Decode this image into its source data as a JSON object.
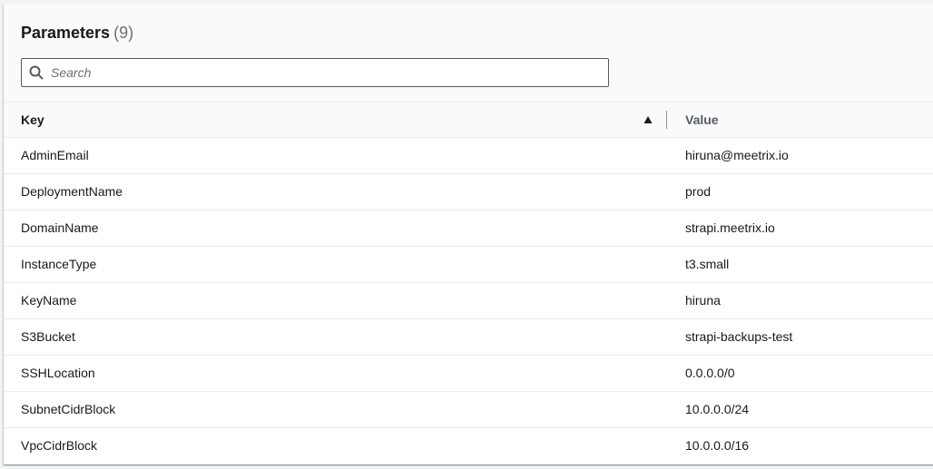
{
  "header": {
    "title": "Parameters",
    "count": "(9)"
  },
  "search": {
    "placeholder": "Search",
    "value": ""
  },
  "table": {
    "columns": {
      "key": "Key",
      "value": "Value"
    },
    "sort": {
      "column": "key",
      "direction": "ascending"
    },
    "rows": [
      {
        "key": "AdminEmail",
        "value": "hiruna@meetrix.io"
      },
      {
        "key": "DeploymentName",
        "value": "prod"
      },
      {
        "key": "DomainName",
        "value": "strapi.meetrix.io"
      },
      {
        "key": "InstanceType",
        "value": "t3.small"
      },
      {
        "key": "KeyName",
        "value": "hiruna"
      },
      {
        "key": "S3Bucket",
        "value": "strapi-backups-test"
      },
      {
        "key": "SSHLocation",
        "value": "0.0.0.0/0"
      },
      {
        "key": "SubnetCidrBlock",
        "value": "10.0.0.0/24"
      },
      {
        "key": "VpcCidrBlock",
        "value": "10.0.0.0/16"
      }
    ]
  },
  "icons": {
    "search": "search-icon",
    "sort": "sort-ascending-icon"
  },
  "colors": {
    "text": "#16191f",
    "muted": "#687078",
    "border": "#eaeded",
    "header_bg": "#fafafa"
  }
}
